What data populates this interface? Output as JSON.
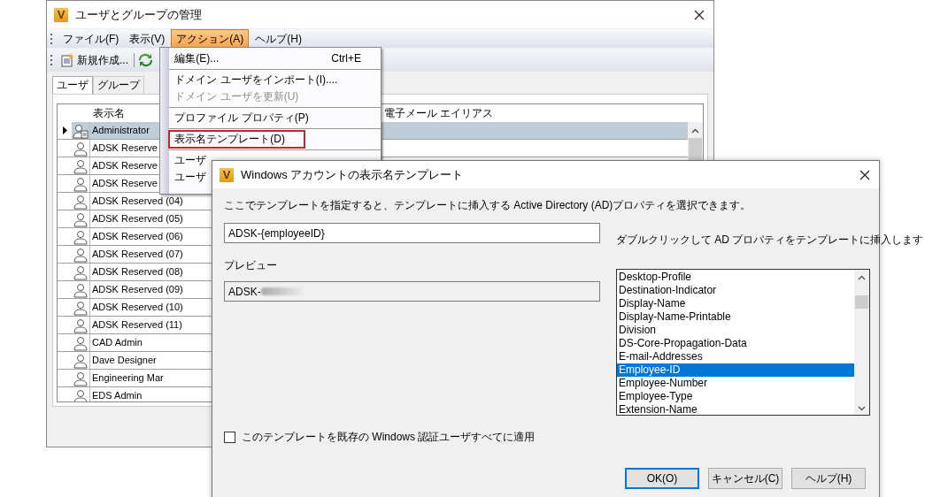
{
  "main_window": {
    "logo": "V",
    "title": "ユーザとグループの管理",
    "menu": [
      {
        "label": "ファイル(F)",
        "selected": false
      },
      {
        "label": "表示(V)",
        "selected": false
      },
      {
        "label": "アクション(A)",
        "selected": true
      },
      {
        "label": "ヘルプ(H)",
        "selected": false
      }
    ],
    "toolbar": {
      "new_button": "新規作成..."
    },
    "tabs": [
      {
        "label": "ユーザ",
        "selected": true
      },
      {
        "label": "グループ",
        "selected": false
      }
    ],
    "table": {
      "columns": [
        "表示名",
        "電子メール エイリアス"
      ],
      "rows": [
        {
          "kind": "admin",
          "name": "Administrator",
          "selected": true
        },
        {
          "kind": "user",
          "name": "ADSK Reserve",
          "selected": false
        },
        {
          "kind": "user",
          "name": "ADSK Reserve",
          "selected": false
        },
        {
          "kind": "user",
          "name": "ADSK Reserve",
          "selected": false
        },
        {
          "kind": "user",
          "name": "ADSK Reserved (04)",
          "selected": false
        },
        {
          "kind": "user",
          "name": "ADSK Reserved (05)",
          "selected": false
        },
        {
          "kind": "user",
          "name": "ADSK Reserved (06)",
          "selected": false
        },
        {
          "kind": "user",
          "name": "ADSK Reserved (07)",
          "selected": false
        },
        {
          "kind": "user",
          "name": "ADSK Reserved (08)",
          "selected": false
        },
        {
          "kind": "user",
          "name": "ADSK Reserved (09)",
          "selected": false
        },
        {
          "kind": "user",
          "name": "ADSK Reserved (10)",
          "selected": false
        },
        {
          "kind": "user",
          "name": "ADSK Reserved (11)",
          "selected": false
        },
        {
          "kind": "user",
          "name": "CAD Admin",
          "selected": false
        },
        {
          "kind": "user",
          "name": "Dave Designer",
          "selected": false
        },
        {
          "kind": "user",
          "name": "Engineering Mar",
          "selected": false
        },
        {
          "kind": "user",
          "name": "EDS Admin",
          "selected": false
        }
      ]
    }
  },
  "action_menu": {
    "items": [
      {
        "kind": "item",
        "label": "編集(E)...",
        "shortcut": "Ctrl+E",
        "disabled": false,
        "highlighted": false
      },
      {
        "kind": "separator"
      },
      {
        "kind": "item",
        "label": "ドメイン ユーザをインポート(I)....",
        "disabled": false,
        "highlighted": false
      },
      {
        "kind": "item",
        "label": "ドメイン ユーザを更新(U)",
        "disabled": true,
        "highlighted": false
      },
      {
        "kind": "separator"
      },
      {
        "kind": "item",
        "label": "プロファイル プロパティ(P)",
        "disabled": false,
        "highlighted": false
      },
      {
        "kind": "separator"
      },
      {
        "kind": "item",
        "label": "表示名テンプレート(D)",
        "disabled": false,
        "highlighted": true
      },
      {
        "kind": "separator"
      },
      {
        "kind": "item",
        "label": "ユーザ",
        "disabled": false,
        "highlighted": false
      },
      {
        "kind": "item",
        "label": "ユーザ",
        "disabled": false,
        "highlighted": false
      }
    ]
  },
  "dialog": {
    "logo": "V",
    "title": "Windows アカウントの表示名テンプレート",
    "description": "ここでテンプレートを指定すると、テンプレートに挿入する Active Directory (AD)プロパティを選択できます。",
    "template_value": "ADSK-{employeeID}",
    "preview_label": "プレビュー",
    "preview_value": "ADSK-",
    "preview_redacted": true,
    "list_hint": "ダブルクリックして AD プロパティをテンプレートに挿入します",
    "properties": [
      {
        "label": "Desktop-Profile",
        "selected": false
      },
      {
        "label": "Destination-Indicator",
        "selected": false
      },
      {
        "label": "Display-Name",
        "selected": false
      },
      {
        "label": "Display-Name-Printable",
        "selected": false
      },
      {
        "label": "Division",
        "selected": false
      },
      {
        "label": "DS-Core-Propagation-Data",
        "selected": false
      },
      {
        "label": "E-mail-Addresses",
        "selected": false
      },
      {
        "label": "Employee-ID",
        "selected": true
      },
      {
        "label": "Employee-Number",
        "selected": false
      },
      {
        "label": "Employee-Type",
        "selected": false
      },
      {
        "label": "Extension-Name",
        "selected": false
      }
    ],
    "apply_all": {
      "label": "このテンプレートを既存の Windows 認証ユーザすべてに適用",
      "checked": false
    },
    "buttons": [
      {
        "label": "OK(O)",
        "default": true
      },
      {
        "label": "キャンセル(C)",
        "default": false
      },
      {
        "label": "ヘルプ(H)",
        "default": false
      }
    ]
  }
}
